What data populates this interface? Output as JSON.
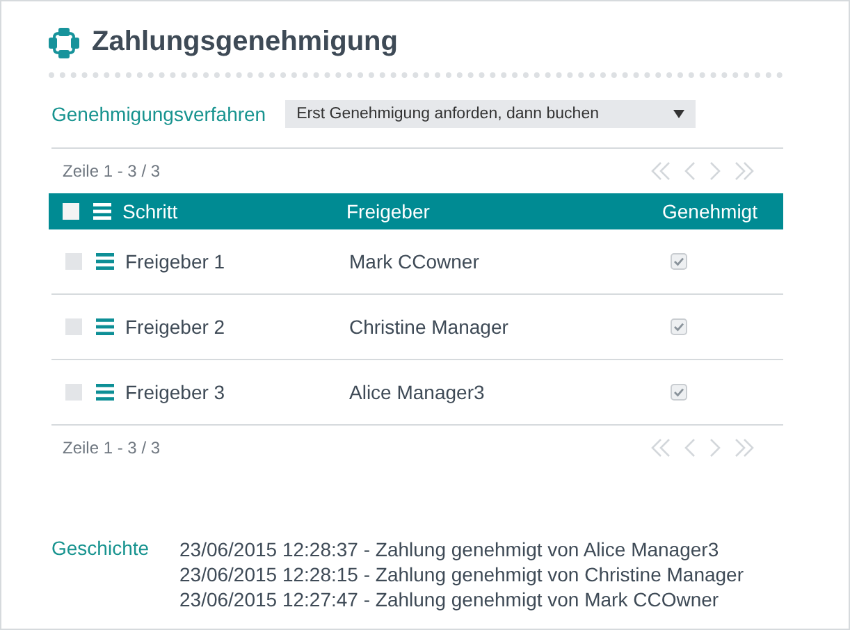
{
  "title": "Zahlungsgenehmigung",
  "procedure": {
    "label": "Genehmigungsverfahren",
    "value": "Erst Genehmigung anforden, dann buchen"
  },
  "table": {
    "pager_top": "Zeile 1 - 3 / 3",
    "pager_bottom": "Zeile 1 - 3 / 3",
    "all_selected": false,
    "columns": [
      "Schritt",
      "Freigeber",
      "Genehmigt"
    ],
    "rows": [
      {
        "step": "Freigeber 1",
        "approver": "Mark CCowner",
        "selected": false,
        "approved": true
      },
      {
        "step": "Freigeber 2",
        "approver": "Christine Manager",
        "selected": false,
        "approved": true
      },
      {
        "step": "Freigeber 3",
        "approver": "Alice Manager3",
        "selected": false,
        "approved": true
      }
    ]
  },
  "history": {
    "label": "Geschichte",
    "entries": [
      "23/06/2015 12:28:37 - Zahlung genehmigt von Alice Manager3",
      "23/06/2015 12:28:15 - Zahlung genehmigt von Christine Manager",
      "23/06/2015 12:27:47 - Zahlung genehmigt von Mark CCOwner"
    ]
  }
}
